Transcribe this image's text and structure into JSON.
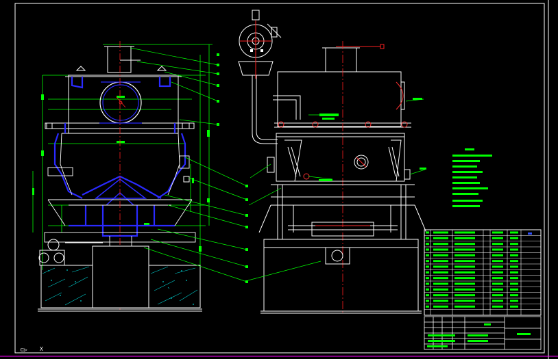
{
  "drawing": {
    "background": "#000000",
    "line_colors": {
      "frame": "#ffffff",
      "equipment": "#ffffff",
      "casing": "#2a2aff",
      "dimension": "#00ff00",
      "leader": "#00ff00",
      "center_line": "#ff2020",
      "piping": "#ff3030",
      "cut_line": "#ff00ff",
      "title_blue_mark": "#3050ff"
    },
    "ucs_axis": "X",
    "views": [
      {
        "name": "front-section-view",
        "callouts": 11
      },
      {
        "name": "side-elevation-view",
        "callouts": 8
      }
    ],
    "technical_notes_lines": 10,
    "parts_list_rows": 14,
    "title_block": "blank"
  }
}
